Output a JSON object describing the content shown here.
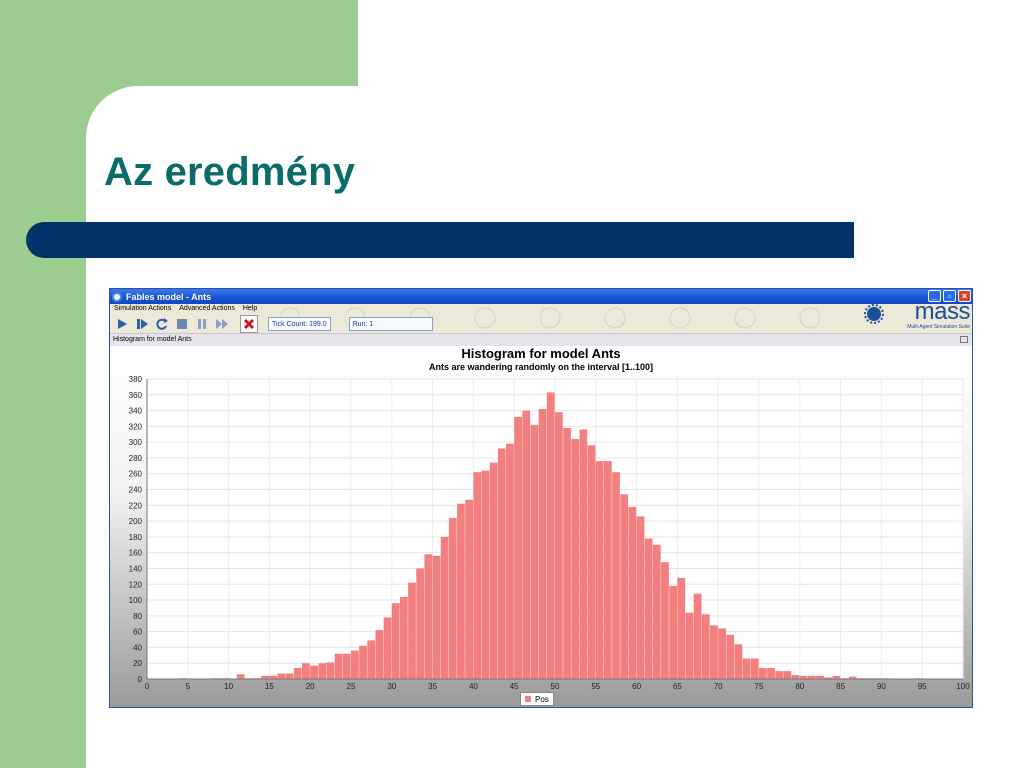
{
  "slide": {
    "title": "Az eredmény",
    "colors": {
      "green": "#9ccc8f",
      "title": "#0b6b68",
      "bar": "#003366"
    }
  },
  "window": {
    "title": "Fables model - Ants",
    "controls": [
      "minimize-icon",
      "restore-icon",
      "close-icon"
    ]
  },
  "menu": [
    "Simulation Actions",
    "Advanced Actions",
    "Help"
  ],
  "toolbar": {
    "icons": [
      "play-icon",
      "step-icon",
      "restart-icon",
      "stop-icon",
      "pause-icon",
      "fast-forward-icon",
      "exit-icon"
    ],
    "tick_count": "Tick Count: 199.0",
    "run": "Run: 1"
  },
  "logo": {
    "text": "mass",
    "subtitle": "Multi-Agent Simulation Suite"
  },
  "panel": {
    "title": "Histogram for model Ants"
  },
  "chart_data": {
    "type": "bar",
    "title": "Histogram for model Ants",
    "subtitle": "Ants are wandering randomly on the interval [1..100]",
    "xlim": [
      0,
      100
    ],
    "ylim": [
      0,
      380
    ],
    "xticks": [
      0,
      5,
      10,
      15,
      20,
      25,
      30,
      35,
      40,
      45,
      50,
      55,
      60,
      65,
      70,
      75,
      80,
      85,
      90,
      95,
      100
    ],
    "yticks": [
      0,
      20,
      40,
      60,
      80,
      100,
      120,
      140,
      160,
      180,
      200,
      220,
      240,
      260,
      280,
      300,
      320,
      340,
      360,
      380
    ],
    "grid": true,
    "legend_position": "bottom-center",
    "series": [
      {
        "name": "Pos",
        "color": "#f47f7f",
        "x": [
          1,
          2,
          3,
          4,
          5,
          6,
          7,
          8,
          9,
          10,
          11,
          12,
          13,
          14,
          15,
          16,
          17,
          18,
          19,
          20,
          21,
          22,
          23,
          24,
          25,
          26,
          27,
          28,
          29,
          30,
          31,
          32,
          33,
          34,
          35,
          36,
          37,
          38,
          39,
          40,
          41,
          42,
          43,
          44,
          45,
          46,
          47,
          48,
          49,
          50,
          51,
          52,
          53,
          54,
          55,
          56,
          57,
          58,
          59,
          60,
          61,
          62,
          63,
          64,
          65,
          66,
          67,
          68,
          69,
          70,
          71,
          72,
          73,
          74,
          75,
          76,
          77,
          78,
          79,
          80,
          81,
          82,
          83,
          84,
          85,
          86,
          87,
          88,
          89,
          90,
          91,
          92,
          93,
          94,
          95,
          96,
          97,
          98,
          99,
          100
        ],
        "values": [
          0,
          0,
          0,
          0,
          1,
          0,
          0,
          0,
          1,
          1,
          0,
          6,
          1,
          1,
          4,
          4,
          7,
          7,
          14,
          20,
          17,
          20,
          21,
          32,
          32,
          36,
          42,
          49,
          62,
          78,
          96,
          104,
          122,
          140,
          158,
          156,
          180,
          204,
          222,
          227,
          262,
          264,
          274,
          292,
          298,
          332,
          340,
          322,
          342,
          363,
          338,
          318,
          304,
          316,
          296,
          276,
          276,
          262,
          234,
          218,
          206,
          178,
          170,
          148,
          118,
          128,
          84,
          108,
          82,
          68,
          64,
          56,
          44,
          26,
          26,
          14,
          14,
          10,
          10,
          5,
          4,
          4,
          4,
          2,
          4,
          1,
          3,
          1,
          1,
          1,
          1,
          0,
          0,
          0,
          1,
          0,
          0,
          0,
          0,
          0
        ]
      }
    ]
  }
}
